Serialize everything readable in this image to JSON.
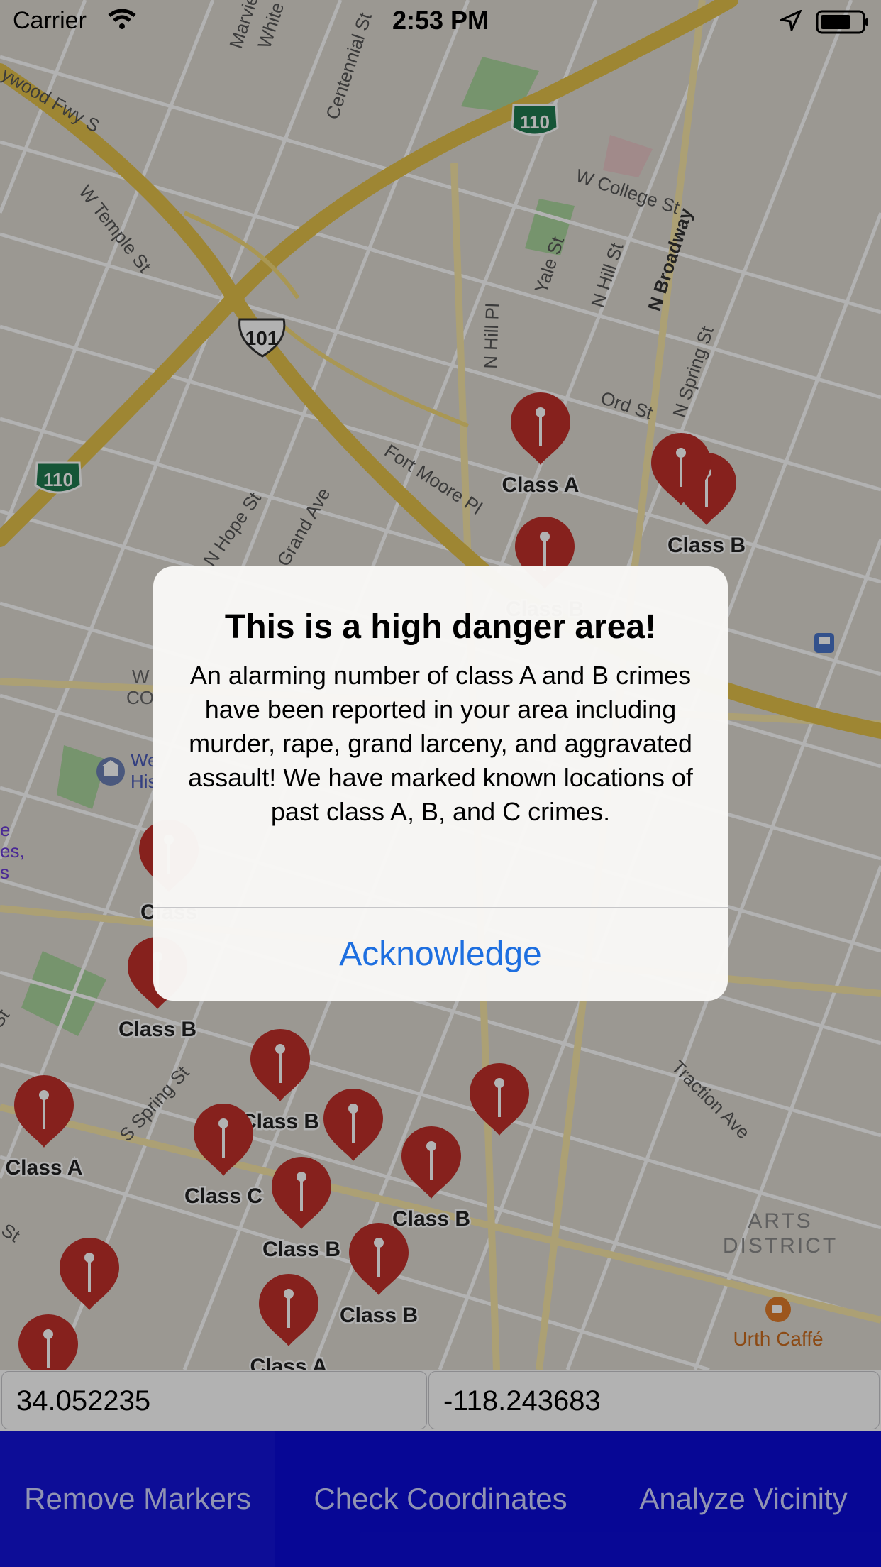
{
  "status_bar": {
    "carrier": "Carrier",
    "time": "2:53 PM"
  },
  "map": {
    "road_labels": [
      "ywood Fwy S",
      "W Temple St",
      "Centennial St",
      "Marvie",
      "White",
      "W College St",
      "Yale St",
      "N Hill St",
      "N Hill Pl",
      "N Broadway",
      "N Spring St",
      "Ord St",
      "Fort Moore Pl",
      "N Hope St",
      "Grand Ave",
      "S Spring St",
      "Traction Ave",
      "St",
      "St"
    ],
    "shields": [
      "110",
      "101",
      "110"
    ],
    "district_label": [
      "ARTS",
      "DISTRICT"
    ],
    "poi": [
      "Urth Caffé"
    ],
    "partial_labels": [
      "W",
      "CO",
      "We",
      "His",
      "e",
      "es,",
      "s",
      "Cla"
    ],
    "markers": [
      {
        "label": "Class A"
      },
      {
        "label": "Class B"
      },
      {
        "label": ""
      },
      {
        "label": "Class B"
      },
      {
        "label": "Class B"
      },
      {
        "label": "Class A"
      },
      {
        "label": "Class B"
      },
      {
        "label": "Class C"
      },
      {
        "label": "Class B"
      },
      {
        "label": "Class B"
      },
      {
        "label": "Class B"
      },
      {
        "label": "Class A"
      },
      {
        "label": ""
      },
      {
        "label": ""
      },
      {
        "label": ""
      },
      {
        "label": "Class"
      },
      {
        "label": ""
      }
    ]
  },
  "alert": {
    "title": "This is a high danger area!",
    "message": "An alarming number of class A and B crimes have been reported in your area including murder, rape, grand larceny, and aggravated assault! We have marked known locations of past class A, B, and C crimes.",
    "button": "Acknowledge"
  },
  "coordinates": {
    "latitude": "34.052235",
    "longitude": "-118.243683"
  },
  "toolbar": {
    "remove_markers": "Remove Markers",
    "check_coordinates": "Check Coordinates",
    "analyze_vicinity": "Analyze Vicinity"
  },
  "colors": {
    "toolbar": "#0b0bd6",
    "accent": "#1e6fe0",
    "marker": "#c0302a",
    "freeway": "#e2c14a"
  }
}
